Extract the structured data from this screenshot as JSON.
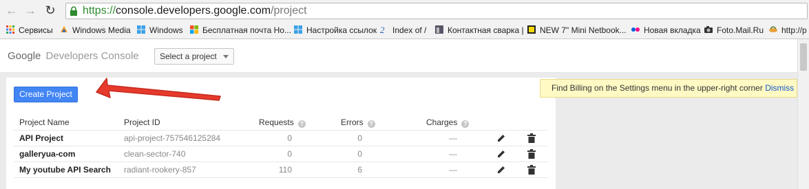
{
  "browser": {
    "url_scheme": "https://",
    "url_host": "console.developers.google.com",
    "url_path": "/project",
    "bookmarks": [
      {
        "label": "Сервисы",
        "icon": "apps-grid-icon"
      },
      {
        "label": "Windows Media",
        "icon": "windows-media-icon"
      },
      {
        "label": "Windows",
        "icon": "windows-logo-icon"
      },
      {
        "label": "Бесплатная почта Но...",
        "icon": "mail-favicon-icon"
      },
      {
        "label": "Настройка ссылок",
        "icon": "windows-logo-icon"
      },
      {
        "label": "Index of /",
        "icon": "folder-favicon-icon"
      },
      {
        "label": "Контактная сварка |",
        "icon": "site-favicon-icon"
      },
      {
        "label": "NEW 7\" Mini Netbook...",
        "icon": "site-favicon-icon"
      },
      {
        "label": "Новая вкладка",
        "icon": "flickr-favicon-icon"
      },
      {
        "label": "Foto.Mail.Ru",
        "icon": "camera-favicon-icon"
      },
      {
        "label": "http://p",
        "icon": "page-favicon-icon"
      }
    ]
  },
  "header": {
    "logo_google": "Google",
    "logo_product": "Developers Console",
    "project_select": "Select a project"
  },
  "toolbar": {
    "create_label": "Create Project"
  },
  "notice": {
    "text": "Find Billing on the Settings menu in the upper-right corner",
    "dismiss": "Dismiss"
  },
  "table": {
    "headers": {
      "name": "Project Name",
      "id": "Project ID",
      "requests": "Requests",
      "errors": "Errors",
      "charges": "Charges"
    },
    "rows": [
      {
        "name": "API Project",
        "id": "api-project-757546125284",
        "requests": "0",
        "errors": "0",
        "charges": "—"
      },
      {
        "name": "galleryua-com",
        "id": "clean-sector-740",
        "requests": "0",
        "errors": "0",
        "charges": "—"
      },
      {
        "name": "My youtube API Search",
        "id": "radiant-rookery-857",
        "requests": "110",
        "errors": "6",
        "charges": "—"
      }
    ]
  },
  "colors": {
    "accent": "#4285f4",
    "annotation_arrow": "#e53a2c",
    "notice_bg": "#fff9c4",
    "secure_green": "#2e8b2e"
  }
}
